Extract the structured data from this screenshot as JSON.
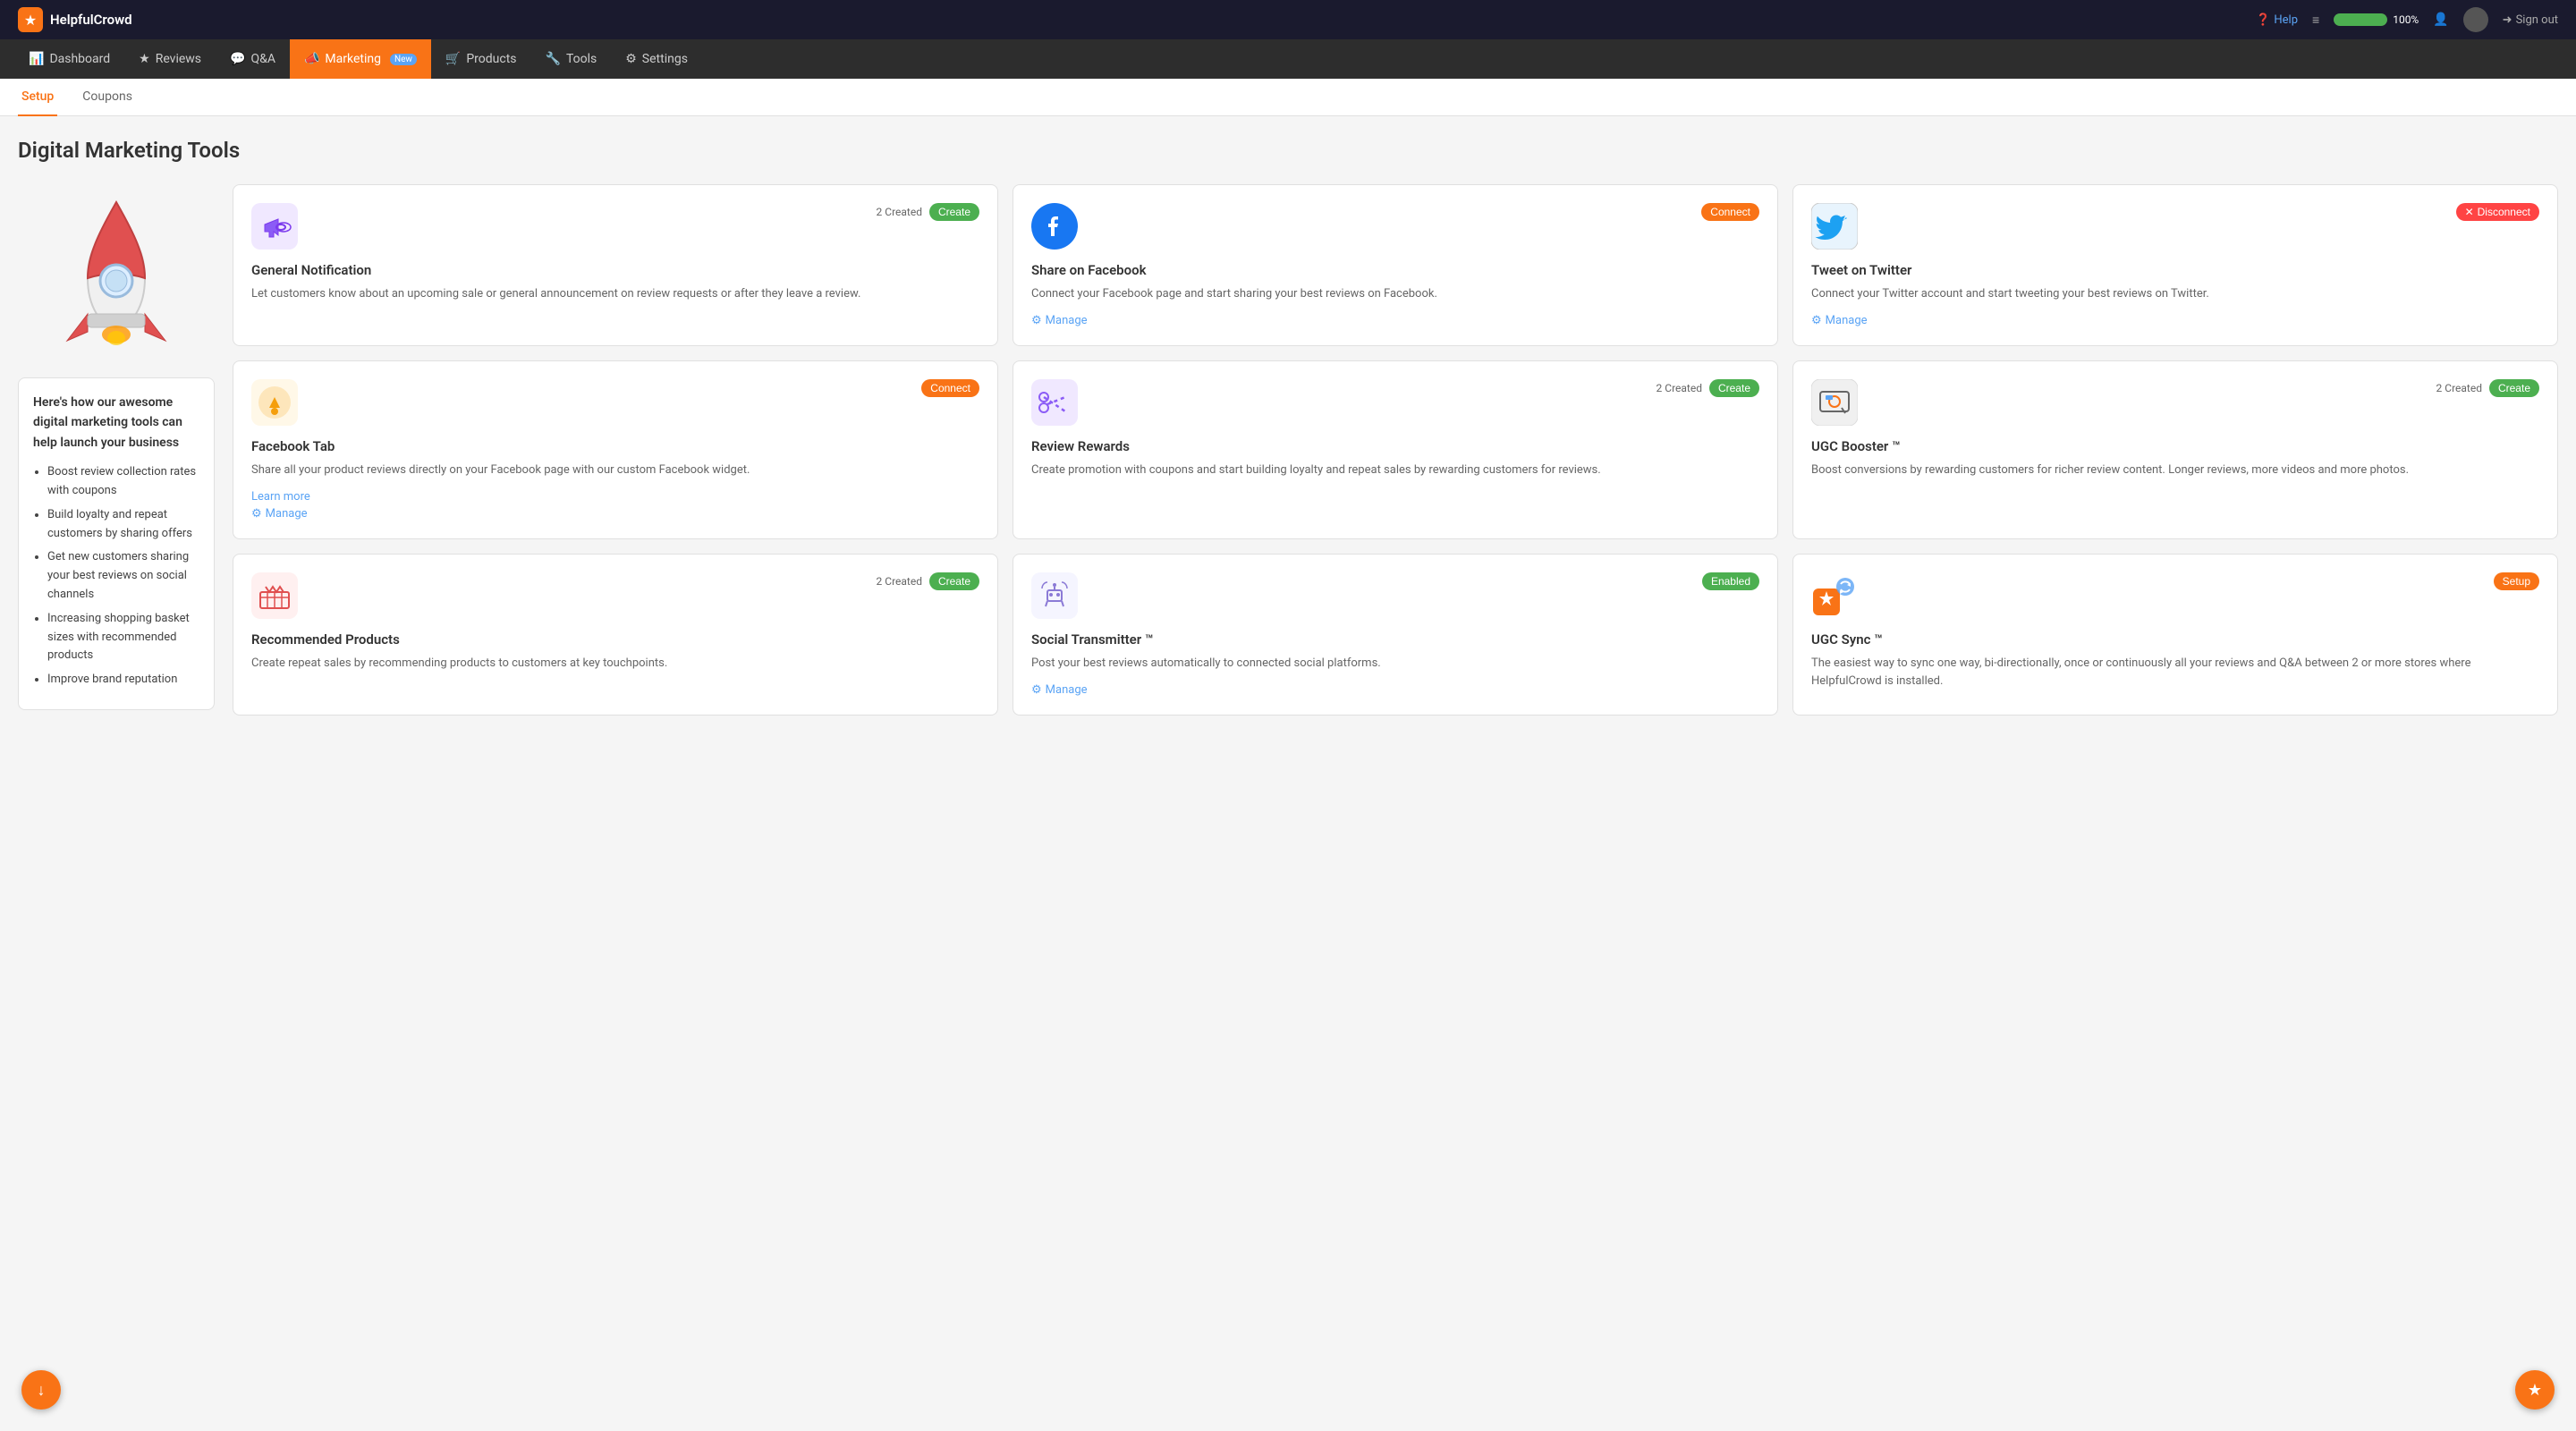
{
  "app": {
    "name": "HelpfulCrowd",
    "logo_char": "★"
  },
  "topbar": {
    "help_label": "Help",
    "progress_label": "100%",
    "progress_value": 100,
    "signout_label": "Sign out"
  },
  "nav": {
    "items": [
      {
        "id": "dashboard",
        "label": "Dashboard",
        "icon": "📊",
        "active": false
      },
      {
        "id": "reviews",
        "label": "Reviews",
        "icon": "★",
        "active": false
      },
      {
        "id": "qa",
        "label": "Q&A",
        "icon": "💬",
        "active": false
      },
      {
        "id": "marketing",
        "label": "Marketing",
        "icon": "📣",
        "active": true,
        "badge": "New"
      },
      {
        "id": "products",
        "label": "Products",
        "icon": "🛒",
        "active": false
      },
      {
        "id": "tools",
        "label": "Tools",
        "icon": "🔧",
        "active": false
      },
      {
        "id": "settings",
        "label": "Settings",
        "icon": "⚙",
        "active": false
      }
    ]
  },
  "subnav": {
    "items": [
      {
        "id": "setup",
        "label": "Setup",
        "active": true
      },
      {
        "id": "coupons",
        "label": "Coupons",
        "active": false
      }
    ]
  },
  "page": {
    "title": "Digital Marketing Tools"
  },
  "sidebar": {
    "info_title": "Here's how our awesome digital marketing tools can help launch your business",
    "bullets": [
      "Boost review collection rates with coupons",
      "Build loyalty and repeat customers by sharing offers",
      "Get new customers sharing your best reviews on social channels",
      "Increasing shopping basket sizes with recommended products",
      "Improve brand reputation"
    ]
  },
  "cards": [
    {
      "id": "general-notification",
      "title": "General Notification",
      "description": "Let customers know about an upcoming sale or general announcement on review requests or after they leave a review.",
      "status": "created",
      "created_count": "2 Created",
      "action_label": "Create",
      "action_type": "create",
      "show_manage": false,
      "show_learn": false
    },
    {
      "id": "share-facebook",
      "title": "Share on Facebook",
      "description": "Connect your Facebook page and start sharing your best reviews on Facebook.",
      "status": "connect",
      "action_label": "Connect",
      "action_type": "connect",
      "show_manage": true,
      "manage_label": "Manage",
      "show_learn": false
    },
    {
      "id": "tweet-twitter",
      "title": "Tweet on Twitter",
      "description": "Connect your Twitter account and start tweeting your best reviews on Twitter.",
      "status": "disconnect",
      "action_label": "Disconnect",
      "action_type": "disconnect",
      "show_manage": true,
      "manage_label": "Manage",
      "show_learn": false
    },
    {
      "id": "facebook-tab",
      "title": "Facebook Tab",
      "description": "Share all your product reviews directly on your Facebook page with our custom Facebook widget.",
      "status": "connect",
      "action_label": "Connect",
      "action_type": "connect",
      "show_manage": true,
      "manage_label": "Manage",
      "show_learn": true,
      "learn_label": "Learn more"
    },
    {
      "id": "review-rewards",
      "title": "Review Rewards",
      "description": "Create promotion with coupons and start building loyalty and repeat sales by rewarding customers for reviews.",
      "status": "created",
      "created_count": "2 Created",
      "action_label": "Create",
      "action_type": "create",
      "show_manage": false,
      "show_learn": false
    },
    {
      "id": "ugc-booster",
      "title": "UGC Booster ™",
      "description": "Boost conversions by rewarding customers for richer review content. Longer reviews, more videos and more photos.",
      "status": "created",
      "created_count": "2 Created",
      "action_label": "Create",
      "action_type": "create",
      "show_manage": false,
      "show_learn": false
    },
    {
      "id": "recommended-products",
      "title": "Recommended Products",
      "description": "Create repeat sales by recommending products to customers at key touchpoints.",
      "status": "created",
      "created_count": "2 Created",
      "action_label": "Create",
      "action_type": "create",
      "show_manage": false,
      "show_learn": false
    },
    {
      "id": "social-transmitter",
      "title": "Social Transmitter ™",
      "description": "Post your best reviews automatically to connected social platforms.",
      "status": "enabled",
      "action_label": "Enabled",
      "action_type": "enabled",
      "show_manage": true,
      "manage_label": "Manage",
      "show_learn": false
    },
    {
      "id": "ugc-sync",
      "title": "UGC Sync ™",
      "description": "The easiest way to sync one way, bi-directionally, once or continuously all your reviews and Q&A between 2 or more stores where HelpfulCrowd is installed.",
      "status": "setup",
      "action_label": "Setup",
      "action_type": "setup",
      "show_manage": false,
      "show_learn": false
    }
  ]
}
